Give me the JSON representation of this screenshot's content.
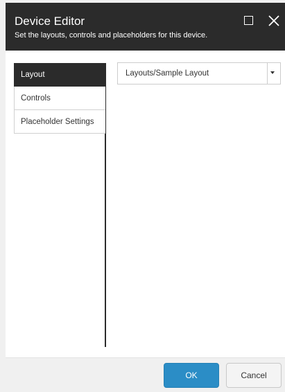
{
  "header": {
    "title": "Device Editor",
    "subtitle": "Set the layouts, controls and placeholders for this device.",
    "maximize_icon": "maximize-icon",
    "close_icon": "close-icon"
  },
  "sidebar": {
    "items": [
      {
        "label": "Layout",
        "active": true
      },
      {
        "label": "Controls",
        "active": false
      },
      {
        "label": "Placeholder Settings",
        "active": false
      }
    ]
  },
  "layout_select": {
    "value": "Layouts/Sample Layout",
    "icon": "chevron-down-icon"
  },
  "footer": {
    "ok_label": "OK",
    "cancel_label": "Cancel"
  },
  "colors": {
    "header_bg": "#2b2b2b",
    "accent": "#2b8dc6",
    "dialog_bg": "#f0f0f0"
  }
}
